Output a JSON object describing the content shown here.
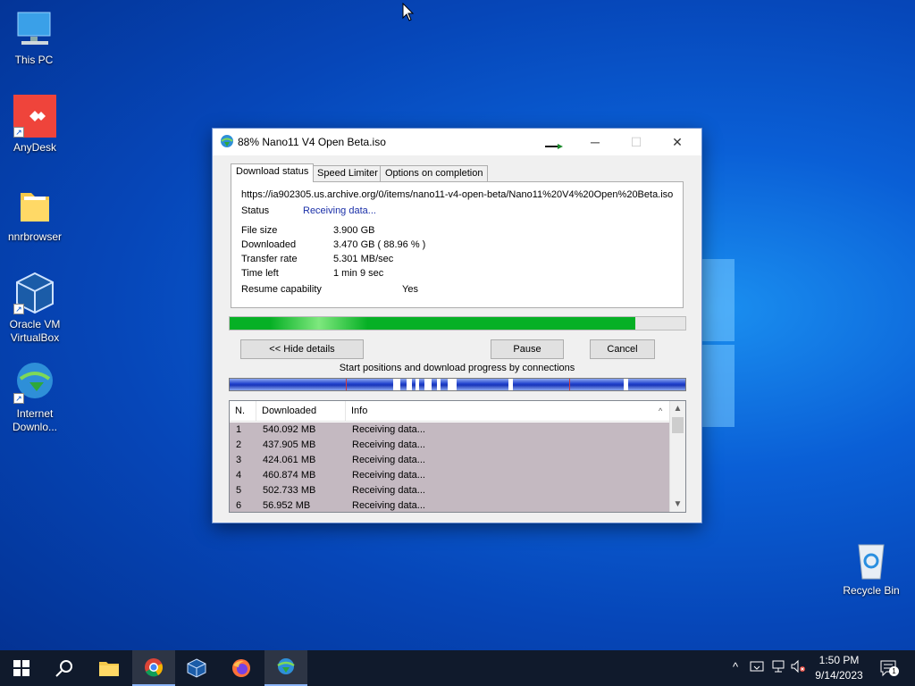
{
  "desktop": {
    "icons": [
      {
        "label": "This PC",
        "icon": "this-pc-icon"
      },
      {
        "label": "AnyDesk",
        "icon": "anydesk-icon"
      },
      {
        "label": "nnrbrowser",
        "icon": "folder-icon"
      },
      {
        "label": "Oracle VM VirtualBox",
        "icon": "virtualbox-icon"
      },
      {
        "label": "Internet Downlo...",
        "icon": "idm-icon"
      },
      {
        "label": "Recycle Bin",
        "icon": "recycle-bin-icon"
      }
    ]
  },
  "dialog": {
    "title": "88% Nano11 V4 Open Beta.iso",
    "tabs": [
      "Download status",
      "Speed Limiter",
      "Options on completion"
    ],
    "active_tab": "Download status",
    "url": "https://ia902305.us.archive.org/0/items/nano11-v4-open-beta/Nano11%20V4%20Open%20Beta.iso",
    "status_label": "Status",
    "status_value": "Receiving data...",
    "file_size_label": "File size",
    "file_size_value": "3.900  GB",
    "downloaded_label": "Downloaded",
    "downloaded_value": "3.470  GB  ( 88.96 % )",
    "transfer_rate_label": "Transfer rate",
    "transfer_rate_value": "5.301  MB/sec",
    "time_left_label": "Time left",
    "time_left_value": "1 min 9 sec",
    "resume_label": "Resume capability",
    "resume_value": "Yes",
    "progress_fraction": 0.8896,
    "hide_details_label": "<< Hide details",
    "pause_label": "Pause",
    "cancel_label": "Cancel",
    "connections_caption": "Start positions and download progress by connections",
    "connections": {
      "columns": [
        "N.",
        "Downloaded",
        "Info"
      ],
      "rows": [
        {
          "n": "1",
          "downloaded": "540.092  MB",
          "info": "Receiving data..."
        },
        {
          "n": "2",
          "downloaded": "437.905  MB",
          "info": "Receiving data..."
        },
        {
          "n": "3",
          "downloaded": "424.061  MB",
          "info": "Receiving data..."
        },
        {
          "n": "4",
          "downloaded": "460.874  MB",
          "info": "Receiving data..."
        },
        {
          "n": "5",
          "downloaded": "502.733  MB",
          "info": "Receiving data..."
        },
        {
          "n": "6",
          "downloaded": "56.952  MB",
          "info": "Receiving data..."
        }
      ]
    }
  },
  "taskbar": {
    "items": [
      "start-icon",
      "search-icon",
      "file-explorer-icon",
      "chrome-icon",
      "virtualbox-icon",
      "firefox-icon",
      "idm-icon"
    ],
    "time": "1:50 PM",
    "date": "9/14/2023",
    "notification_count": "1"
  },
  "colors": {
    "progress_green": "#06b025",
    "status_blue": "#1a2fa8",
    "taskbar": "#101a2c"
  }
}
